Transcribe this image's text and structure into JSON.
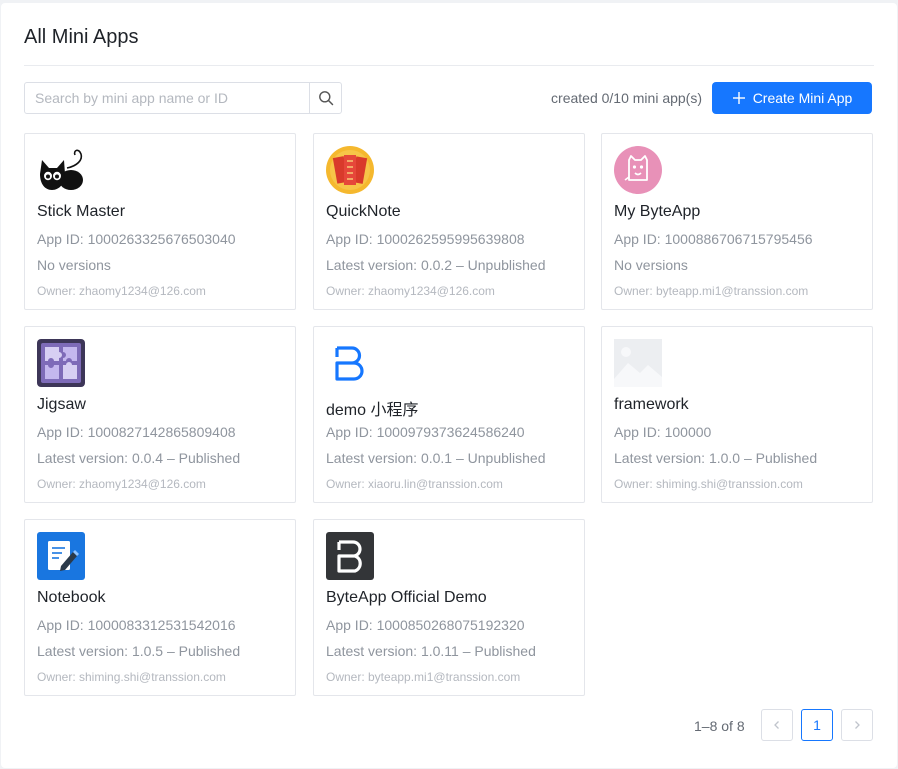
{
  "page": {
    "title": "All Mini Apps"
  },
  "search": {
    "placeholder": "Search by mini app name or ID"
  },
  "toolbar": {
    "created_count": "created 0/10 mini app(s)",
    "create_label": "Create Mini App",
    "create_icon": "plus-icon"
  },
  "apps": [
    {
      "name": "Stick Master",
      "app_id": "App ID: 1000263325676503040",
      "version": "No versions",
      "owner": "Owner: zhaomy1234@126.com",
      "icon": "cat-icon"
    },
    {
      "name": "QuickNote",
      "app_id": "App ID: 1000262595995639808",
      "version": "Latest version: 0.0.2 – Unpublished",
      "owner": "Owner: zhaomy1234@126.com",
      "icon": "couplet-icon"
    },
    {
      "name": "My ByteApp",
      "app_id": "App ID: 1000886706715795456",
      "version": "No versions",
      "owner": "Owner: byteapp.mi1@transsion.com",
      "icon": "pink-cat-icon"
    },
    {
      "name": "Jigsaw",
      "app_id": "App ID: 1000827142865809408",
      "version": "Latest version: 0.0.4 – Published",
      "owner": "Owner: zhaomy1234@126.com",
      "icon": "puzzle-icon"
    },
    {
      "name": "demo 小程序",
      "app_id": "App ID: 1000979373624586240",
      "version": "Latest version: 0.0.1 – Unpublished",
      "owner": "Owner: xiaoru.lin@transsion.com",
      "icon": "byteapp-logo-blue-icon"
    },
    {
      "name": "framework",
      "app_id": "App ID: 100000",
      "version": "Latest version: 1.0.0 – Published",
      "owner": "Owner: shiming.shi@transsion.com",
      "icon": "image-placeholder-icon"
    },
    {
      "name": "Notebook",
      "app_id": "App ID: 1000083312531542016",
      "version": "Latest version: 1.0.5 – Published",
      "owner": "Owner: shiming.shi@transsion.com",
      "icon": "notebook-icon"
    },
    {
      "name": "ByteApp Official Demo",
      "app_id": "App ID: 1000850268075192320",
      "version": "Latest version: 1.0.11 – Published",
      "owner": "Owner: byteapp.mi1@transsion.com",
      "icon": "byteapp-logo-dark-icon"
    }
  ],
  "pagination": {
    "range": "1–8 of 8",
    "current": "1",
    "prev": "‹",
    "next": "›"
  },
  "colors": {
    "primary": "#1677ff",
    "text": "#1f2329",
    "muted": "#8f959e",
    "border": "#e4e6eb"
  }
}
